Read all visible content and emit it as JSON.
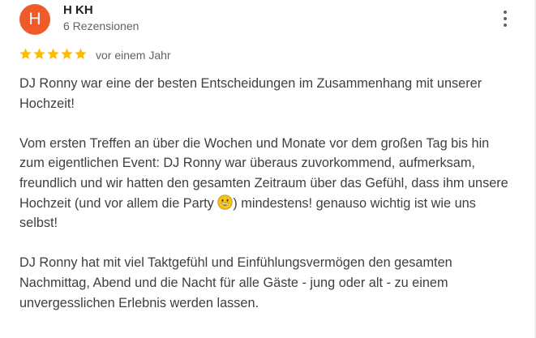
{
  "review": {
    "author_initial": "H",
    "author_name": "H KH",
    "review_count": "6 Rezensionen",
    "rating": 5,
    "rating_max": 5,
    "date": "vor einem Jahr",
    "paragraph1": "DJ Ronny war eine der besten Entscheidungen im Zusammenhang mit unserer Hochzeit!",
    "paragraph2_before_emoji": "Vom ersten Treffen an über die Wochen und Monate vor dem großen Tag bis hin zum eigentlichen Event: DJ Ronny war überaus zuvorkommend, aufmerksam, freundlich und wir hatten den gesamten Zeitraum über das Gefühl, dass ihm unsere Hochzeit (und vor allem die Party ",
    "paragraph2_after_emoji": ") mindestens! genauso wichtig ist wie uns selbst!",
    "paragraph3": "DJ Ronny hat mit viel Taktgefühl und Einfühlungsvermögen den gesamten Nachmittag, Abend und die Nacht für alle Gäste - jung oder alt - zu einem unvergesslichen Erlebnis werden lassen."
  },
  "colors": {
    "avatar_bg": "#f05a28",
    "star": "#fbbc04",
    "secondary_text": "#5f6368",
    "body_text": "#3c4043"
  },
  "icons": {
    "more": "more-vert-icon",
    "star": "star-icon",
    "emoji": "grinning-face-emoji"
  }
}
